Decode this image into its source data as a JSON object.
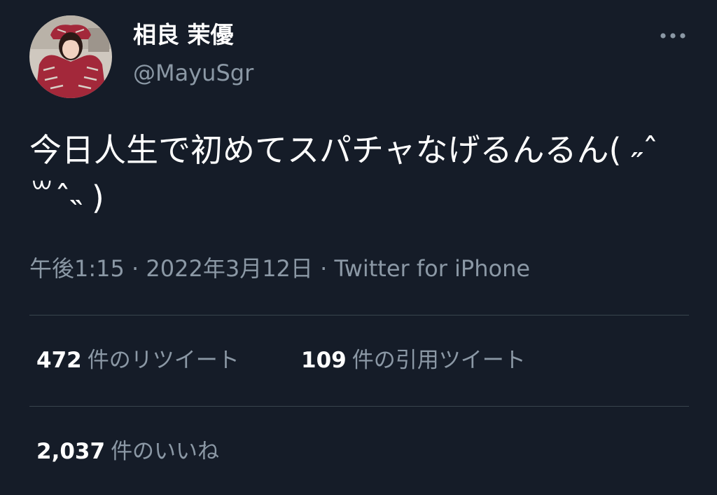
{
  "author": {
    "display_name": "相良 茉優",
    "handle": "@MayuSgr"
  },
  "tweet": {
    "text": "今日人生で初めてスパチャなげるんるん( ˶ˆ꒳ˆ˵ )",
    "time": "午後1:15",
    "separator": "·",
    "date": "2022年3月12日",
    "source": "Twitter for iPhone"
  },
  "stats": {
    "retweets": {
      "count": "472",
      "label": "件のリツイート"
    },
    "quotes": {
      "count": "109",
      "label": "件の引用ツイート"
    },
    "likes": {
      "count": "2,037",
      "label": "件のいいね"
    }
  },
  "icons": {
    "more": "more-horizontal-icon",
    "avatar": "profile-avatar"
  },
  "colors": {
    "background": "#151c28",
    "primary_text": "#ffffff",
    "secondary_text": "#8b98a5",
    "divider": "#38444d"
  }
}
